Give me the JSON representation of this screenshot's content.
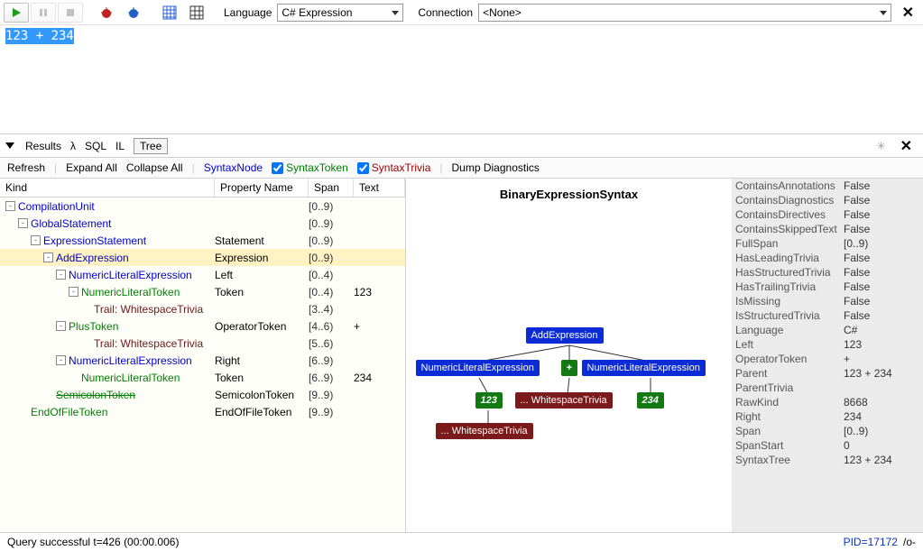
{
  "toolbar": {
    "language_label": "Language",
    "language_value": "C# Expression",
    "connection_label": "Connection",
    "connection_value": "<None>"
  },
  "editor": {
    "selected_text": "123 + 234"
  },
  "midtabs": {
    "results": "Results",
    "lambda": "λ",
    "sql": "SQL",
    "il": "IL",
    "tree": "Tree"
  },
  "actions": {
    "refresh": "Refresh",
    "expand": "Expand All",
    "collapse": "Collapse All",
    "syntaxnode": "SyntaxNode",
    "syntaxtoken": "SyntaxToken",
    "syntaxtrivia": "SyntaxTrivia",
    "dump": "Dump Diagnostics"
  },
  "grid": {
    "kind": "Kind",
    "prop": "Property Name",
    "span": "Span",
    "text": "Text"
  },
  "tree": [
    {
      "indent": 0,
      "tw": "-",
      "kind": "CompilationUnit",
      "cls": "node-blue",
      "prop": "",
      "span": "[0..9)",
      "text": ""
    },
    {
      "indent": 1,
      "tw": "-",
      "kind": "GlobalStatement",
      "cls": "node-blue",
      "prop": "",
      "span": "[0..9)",
      "text": ""
    },
    {
      "indent": 2,
      "tw": "-",
      "kind": "ExpressionStatement",
      "cls": "node-blue",
      "prop": "Statement",
      "span": "[0..9)",
      "text": ""
    },
    {
      "indent": 3,
      "tw": "-",
      "kind": "AddExpression",
      "cls": "node-blue",
      "prop": "Expression",
      "span": "[0..9)",
      "text": "",
      "sel": true
    },
    {
      "indent": 4,
      "tw": "-",
      "kind": "NumericLiteralExpression",
      "cls": "node-blue",
      "prop": "Left",
      "span": "[0..4)",
      "text": ""
    },
    {
      "indent": 5,
      "tw": "-",
      "kind": "NumericLiteralToken",
      "cls": "node-green",
      "prop": "Token",
      "span": "[0..4)",
      "text": "123"
    },
    {
      "indent": 6,
      "tw": "",
      "kind": "Trail: WhitespaceTrivia",
      "cls": "node-dark",
      "prop": "",
      "span": "[3..4)",
      "text": ""
    },
    {
      "indent": 4,
      "tw": "-",
      "kind": "PlusToken",
      "cls": "node-green",
      "prop": "OperatorToken",
      "span": "[4..6)",
      "text": "+"
    },
    {
      "indent": 6,
      "tw": "",
      "kind": "Trail: WhitespaceTrivia",
      "cls": "node-dark",
      "prop": "",
      "span": "[5..6)",
      "text": ""
    },
    {
      "indent": 4,
      "tw": "-",
      "kind": "NumericLiteralExpression",
      "cls": "node-blue",
      "prop": "Right",
      "span": "[6..9)",
      "text": ""
    },
    {
      "indent": 5,
      "tw": "",
      "kind": "NumericLiteralToken",
      "cls": "node-green",
      "prop": "Token",
      "span": "[6..9)",
      "text": "234"
    },
    {
      "indent": 3,
      "tw": "",
      "kind": "SemicolonToken",
      "cls": "node-strike",
      "prop": "SemicolonToken",
      "span": "[9..9)",
      "text": ""
    },
    {
      "indent": 1,
      "tw": "",
      "kind": "EndOfFileToken",
      "cls": "node-green",
      "prop": "EndOfFileToken",
      "span": "[9..9)",
      "text": ""
    }
  ],
  "diagram": {
    "title": "BinaryExpressionSyntax",
    "nodes": {
      "add": "AddExpression",
      "nle1": "NumericLiteralExpression",
      "plus": "+",
      "nle2": "NumericLiteralExpression",
      "v123": "123",
      "wt1": "... WhitespaceTrivia",
      "v234": "234",
      "wt2": "... WhitespaceTrivia"
    }
  },
  "props": [
    {
      "k": "ContainsAnnotations",
      "v": "False"
    },
    {
      "k": "ContainsDiagnostics",
      "v": "False"
    },
    {
      "k": "ContainsDirectives",
      "v": "False"
    },
    {
      "k": "ContainsSkippedText",
      "v": "False"
    },
    {
      "k": "FullSpan",
      "v": "[0..9)"
    },
    {
      "k": "HasLeadingTrivia",
      "v": "False"
    },
    {
      "k": "HasStructuredTrivia",
      "v": "False"
    },
    {
      "k": "HasTrailingTrivia",
      "v": "False"
    },
    {
      "k": "IsMissing",
      "v": "False"
    },
    {
      "k": "IsStructuredTrivia",
      "v": "False"
    },
    {
      "k": "Language",
      "v": "C#"
    },
    {
      "k": "Left",
      "v": "123"
    },
    {
      "k": "OperatorToken",
      "v": "+"
    },
    {
      "k": "Parent",
      "v": "123 + 234"
    },
    {
      "k": "ParentTrivia",
      "v": ""
    },
    {
      "k": "RawKind",
      "v": "8668"
    },
    {
      "k": "Right",
      "v": "234"
    },
    {
      "k": "Span",
      "v": "[0..9)"
    },
    {
      "k": "SpanStart",
      "v": "0"
    },
    {
      "k": "SyntaxTree",
      "v": "123 + 234"
    }
  ],
  "status": {
    "msg": "Query successful t=426  (00:00.006)",
    "pid": "PID=17172",
    "end": "/o-"
  }
}
